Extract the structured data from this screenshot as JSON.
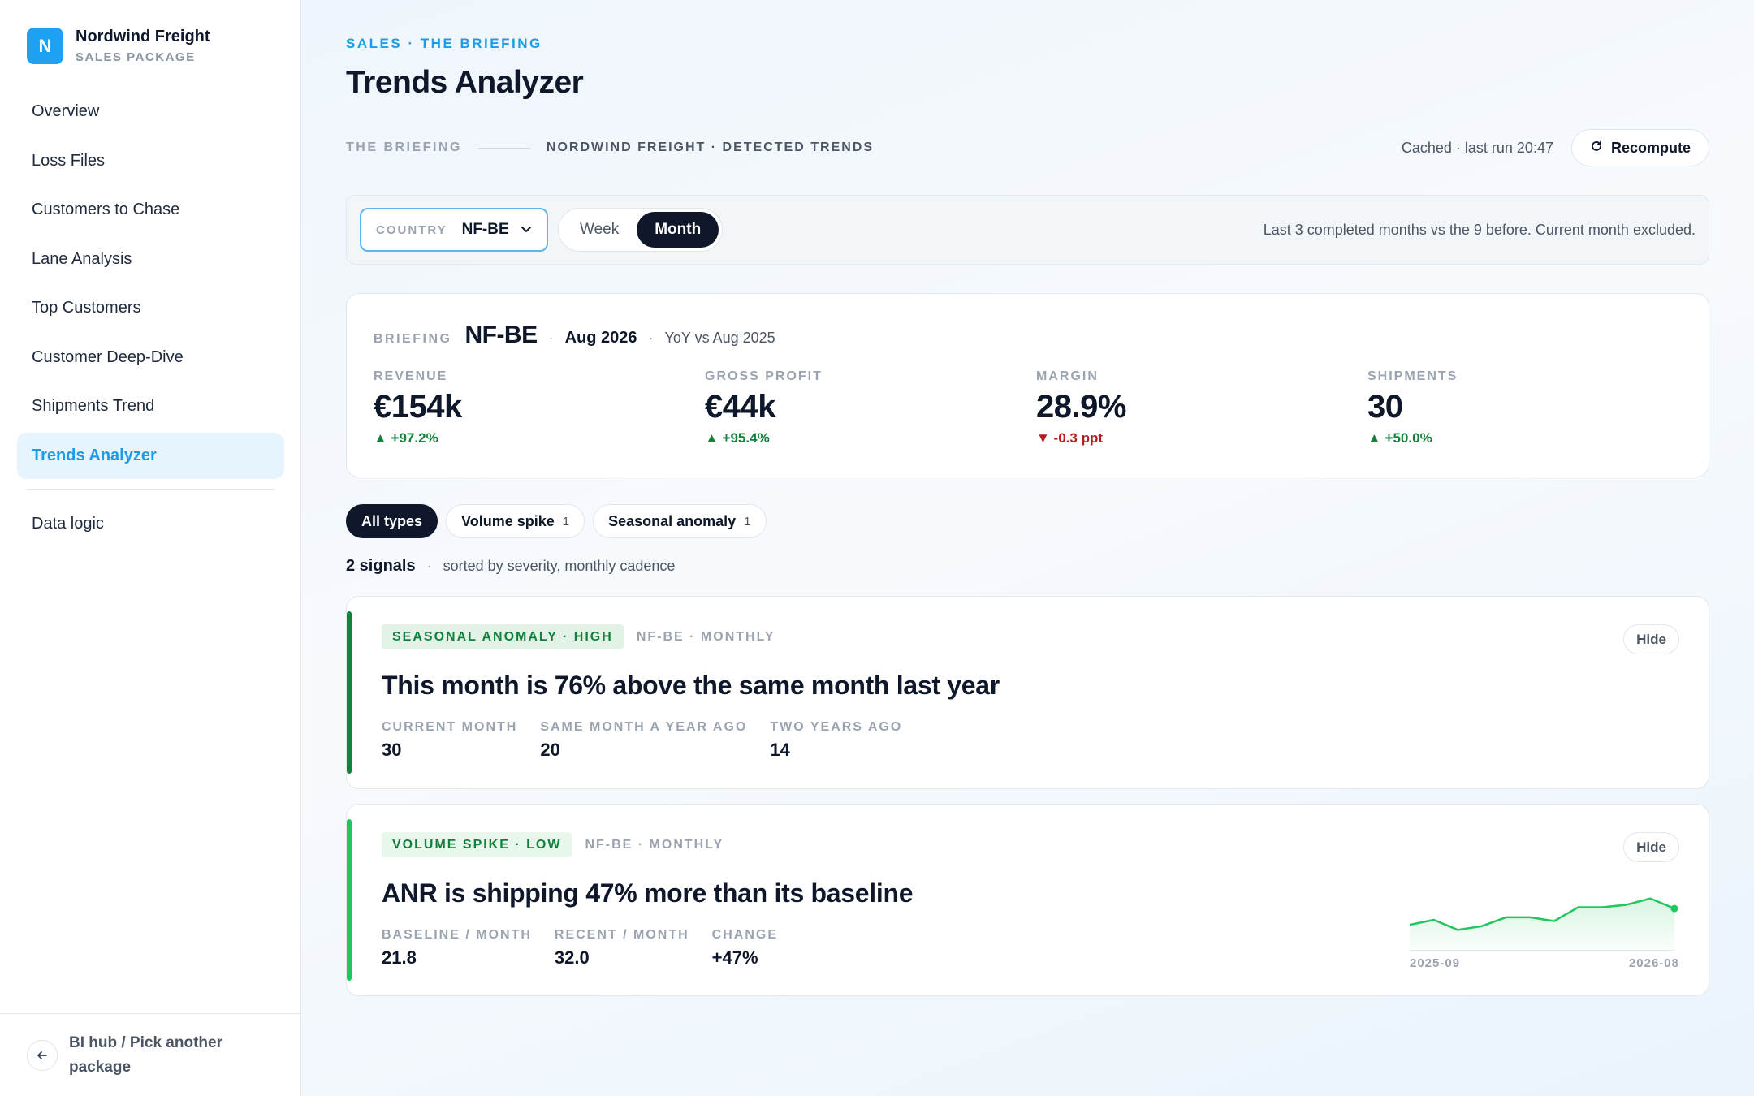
{
  "brand": {
    "initial": "N",
    "name": "Nordwind Freight",
    "sub": "SALES PACKAGE"
  },
  "nav": {
    "items": [
      {
        "label": "Overview"
      },
      {
        "label": "Loss Files"
      },
      {
        "label": "Customers to Chase"
      },
      {
        "label": "Lane Analysis"
      },
      {
        "label": "Top Customers"
      },
      {
        "label": "Customer Deep-Dive"
      },
      {
        "label": "Shipments Trend"
      },
      {
        "label": "Trends Analyzer",
        "active": true
      }
    ],
    "extra": "Data logic",
    "back_label": "BI hub / Pick another package"
  },
  "header": {
    "crumb": "SALES · THE BRIEFING",
    "title": "Trends Analyzer",
    "sub_left": "THE BRIEFING",
    "sub_right": "NORDWIND FREIGHT · DETECTED TRENDS",
    "cached": "Cached · last run 20:47",
    "recompute": "Recompute"
  },
  "filters": {
    "country_label": "COUNTRY",
    "country_value": "NF-BE",
    "cadence": [
      "Week",
      "Month"
    ],
    "cadence_selected": "Month",
    "note": "Last 3 completed months vs the 9 before. Current month excluded."
  },
  "briefing": {
    "label": "BRIEFING",
    "country": "NF-BE",
    "period": "Aug 2026",
    "yoy": "YoY vs Aug 2025",
    "kpis": [
      {
        "label": "REVENUE",
        "value": "€154k",
        "delta": "▲ +97.2%",
        "dir": "up"
      },
      {
        "label": "GROSS PROFIT",
        "value": "€44k",
        "delta": "▲ +95.4%",
        "dir": "up"
      },
      {
        "label": "MARGIN",
        "value": "28.9%",
        "delta": "▼ -0.3 ppt",
        "dir": "down"
      },
      {
        "label": "SHIPMENTS",
        "value": "30",
        "delta": "▲ +50.0%",
        "dir": "up"
      }
    ]
  },
  "chips": [
    {
      "label": "All types",
      "count": "",
      "active": true
    },
    {
      "label": "Volume spike",
      "count": "1"
    },
    {
      "label": "Seasonal anomaly",
      "count": "1"
    }
  ],
  "signals": {
    "count": "2 signals",
    "note": "sorted by severity, monthly cadence",
    "cards": [
      {
        "tag": "SEASONAL ANOMALY · HIGH",
        "meta": "NF-BE · MONTHLY",
        "title": "This month is 76% above the same month last year",
        "hide": "Hide",
        "accent": "#15803d",
        "tag_bg": "#e3f2e7",
        "tag_color": "#15803d",
        "metrics": [
          {
            "label": "CURRENT MONTH",
            "value": "30"
          },
          {
            "label": "SAME MONTH A YEAR AGO",
            "value": "20"
          },
          {
            "label": "TWO YEARS AGO",
            "value": "14"
          }
        ]
      },
      {
        "tag": "VOLUME SPIKE · LOW",
        "meta": "NF-BE · MONTHLY",
        "title": "ANR is shipping 47% more than its baseline",
        "hide": "Hide",
        "accent": "#22c55e",
        "tag_bg": "#e7f7ec",
        "tag_color": "#15803d",
        "metrics": [
          {
            "label": "BASELINE / MONTH",
            "value": "21.8"
          },
          {
            "label": "RECENT / MONTH",
            "value": "32.0"
          },
          {
            "label": "CHANGE",
            "value": "+47%"
          }
        ],
        "spark": {
          "start": "2025-09",
          "end": "2026-08",
          "values": [
            19,
            21,
            17,
            18.5,
            22,
            22,
            20.5,
            26,
            26,
            27,
            29.5,
            25.5
          ]
        }
      }
    ]
  }
}
